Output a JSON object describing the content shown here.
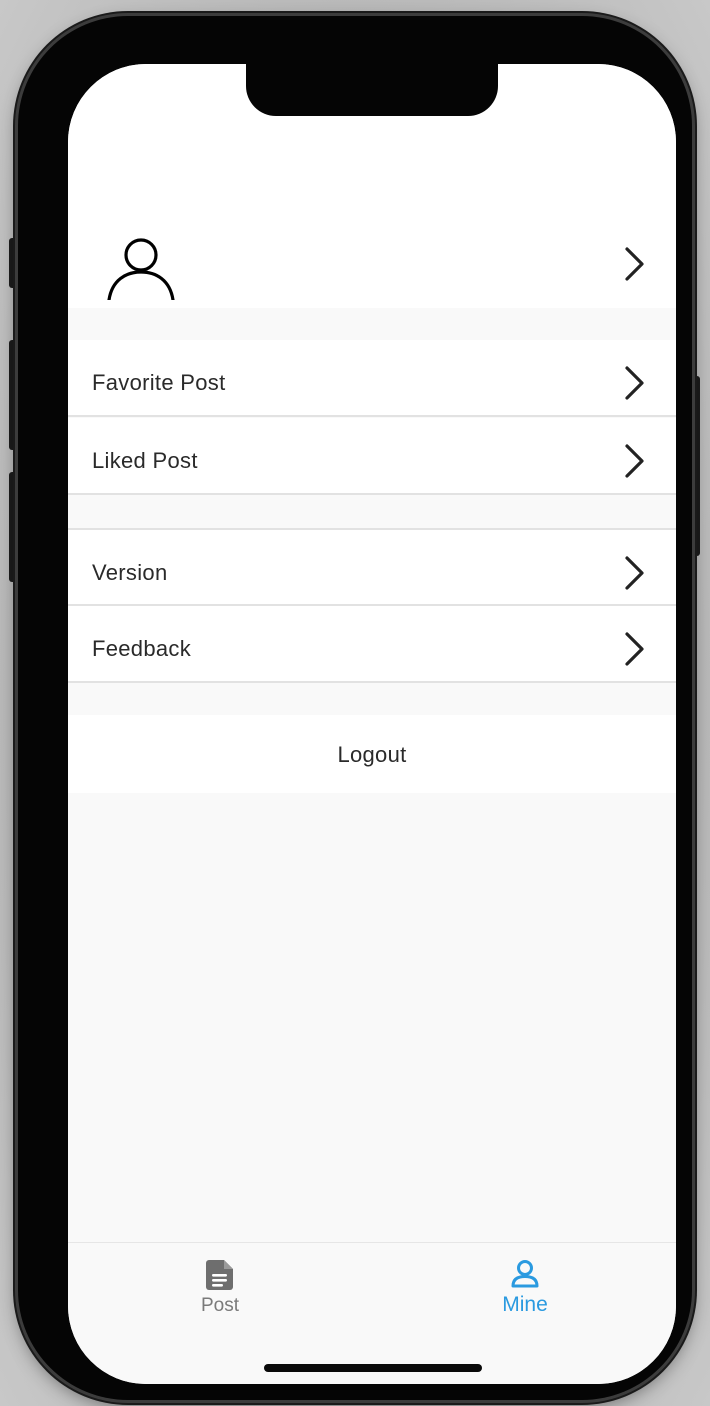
{
  "profile": {
    "avatar_icon": "person-outline-icon",
    "chevron_icon": "chevron-right-icon"
  },
  "menu": {
    "group1": [
      {
        "label": "Favorite Post"
      },
      {
        "label": "Liked Post"
      }
    ],
    "group2": [
      {
        "label": "Version"
      },
      {
        "label": "Feedback"
      }
    ]
  },
  "logout": {
    "label": "Logout"
  },
  "tabbar": {
    "tabs": [
      {
        "label": "Post",
        "icon": "document-icon",
        "active": false
      },
      {
        "label": "Mine",
        "icon": "person-icon",
        "active": true
      }
    ],
    "active_color": "#2a9ae0",
    "inactive_color": "#7a7a7a"
  }
}
